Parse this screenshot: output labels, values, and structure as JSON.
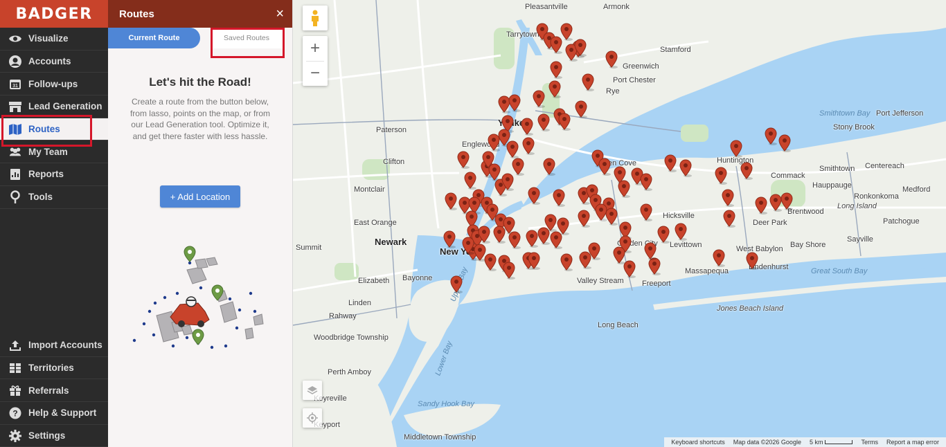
{
  "app": {
    "logo": "BADGER"
  },
  "sidebar": {
    "top_items": [
      {
        "label": "Visualize",
        "icon": "eye-icon"
      },
      {
        "label": "Accounts",
        "icon": "user-circle-icon"
      },
      {
        "label": "Follow-ups",
        "icon": "calendar-icon",
        "badge": "31"
      },
      {
        "label": "Lead Generation",
        "icon": "storefront-icon"
      },
      {
        "label": "Routes",
        "icon": "map-icon",
        "active": true
      },
      {
        "label": "My Team",
        "icon": "team-icon"
      },
      {
        "label": "Reports",
        "icon": "reports-icon"
      },
      {
        "label": "Tools",
        "icon": "pin-outline-icon"
      }
    ],
    "bottom_items": [
      {
        "label": "Import Accounts",
        "icon": "upload-icon"
      },
      {
        "label": "Territories",
        "icon": "grid-icon"
      },
      {
        "label": "Referrals",
        "icon": "gift-icon"
      },
      {
        "label": "Help & Support",
        "icon": "help-icon"
      },
      {
        "label": "Settings",
        "icon": "gear-icon"
      }
    ]
  },
  "panel": {
    "title": "Routes",
    "close_label": "×",
    "tabs": {
      "current": "Current Route",
      "saved": "Saved Routes"
    },
    "heading": "Let's hit the Road!",
    "description": "Create a route from the button below, from lasso, points on the map, or from our Lead Generation tool. Optimize it, and get there faster with less hassle.",
    "add_button": "+ Add Location"
  },
  "map": {
    "labels": [
      {
        "text": "Pleasantville"
      },
      {
        "text": "Armonk"
      },
      {
        "text": "Tarrytown"
      },
      {
        "text": "Stamford"
      },
      {
        "text": "Greenwich"
      },
      {
        "text": "Rye"
      },
      {
        "text": "Port Chester"
      },
      {
        "text": "Yonkers"
      },
      {
        "text": "Paterson"
      },
      {
        "text": "Englewood"
      },
      {
        "text": "Clifton"
      },
      {
        "text": "Montclair"
      },
      {
        "text": "East Orange"
      },
      {
        "text": "Newark"
      },
      {
        "text": "New York"
      },
      {
        "text": "Summit"
      },
      {
        "text": "Elizabeth"
      },
      {
        "text": "Bayonne"
      },
      {
        "text": "Linden"
      },
      {
        "text": "Rahway"
      },
      {
        "text": "Woodbridge Township"
      },
      {
        "text": "Perth Amboy"
      },
      {
        "text": "Keyreville"
      },
      {
        "text": "Middletown Township"
      },
      {
        "text": "Glen Cove"
      },
      {
        "text": "Hicksville"
      },
      {
        "text": "Garden City"
      },
      {
        "text": "Levittown"
      },
      {
        "text": "Valley Stream"
      },
      {
        "text": "Freeport"
      },
      {
        "text": "Long Beach"
      },
      {
        "text": "Massapequa"
      },
      {
        "text": "Lindenhurst"
      },
      {
        "text": "West Babylon"
      },
      {
        "text": "Bay Shore"
      },
      {
        "text": "Deer Park"
      },
      {
        "text": "Huntington"
      },
      {
        "text": "Commack"
      },
      {
        "text": "Smithtown"
      },
      {
        "text": "Hauppauge"
      },
      {
        "text": "Brentwood"
      },
      {
        "text": "Stony Brook"
      },
      {
        "text": "Port Jefferson"
      },
      {
        "text": "Centereach"
      },
      {
        "text": "Ronkonkoma"
      },
      {
        "text": "Medford"
      },
      {
        "text": "Patchogue"
      },
      {
        "text": "Sayville"
      },
      {
        "text": "Long Island"
      },
      {
        "text": "Jones Beach Island"
      },
      {
        "text": "Smithtown Bay"
      },
      {
        "text": "Great South Bay"
      },
      {
        "text": "Sandy Hook Bay"
      },
      {
        "text": "Lower Bay"
      },
      {
        "text": "Upper Bay"
      },
      {
        "text": "Keyport"
      }
    ],
    "attribution": {
      "shortcuts": "Keyboard shortcuts",
      "data": "Map data ©2026 Google",
      "scale": "5 km",
      "terms": "Terms",
      "report": "Report a map error"
    },
    "zoom_in": "+",
    "zoom_out": "−",
    "colors": {
      "pin": "#c8432b",
      "water": "#a9d3f4",
      "land": "#eef0ea",
      "park": "#cfe6c3"
    }
  }
}
